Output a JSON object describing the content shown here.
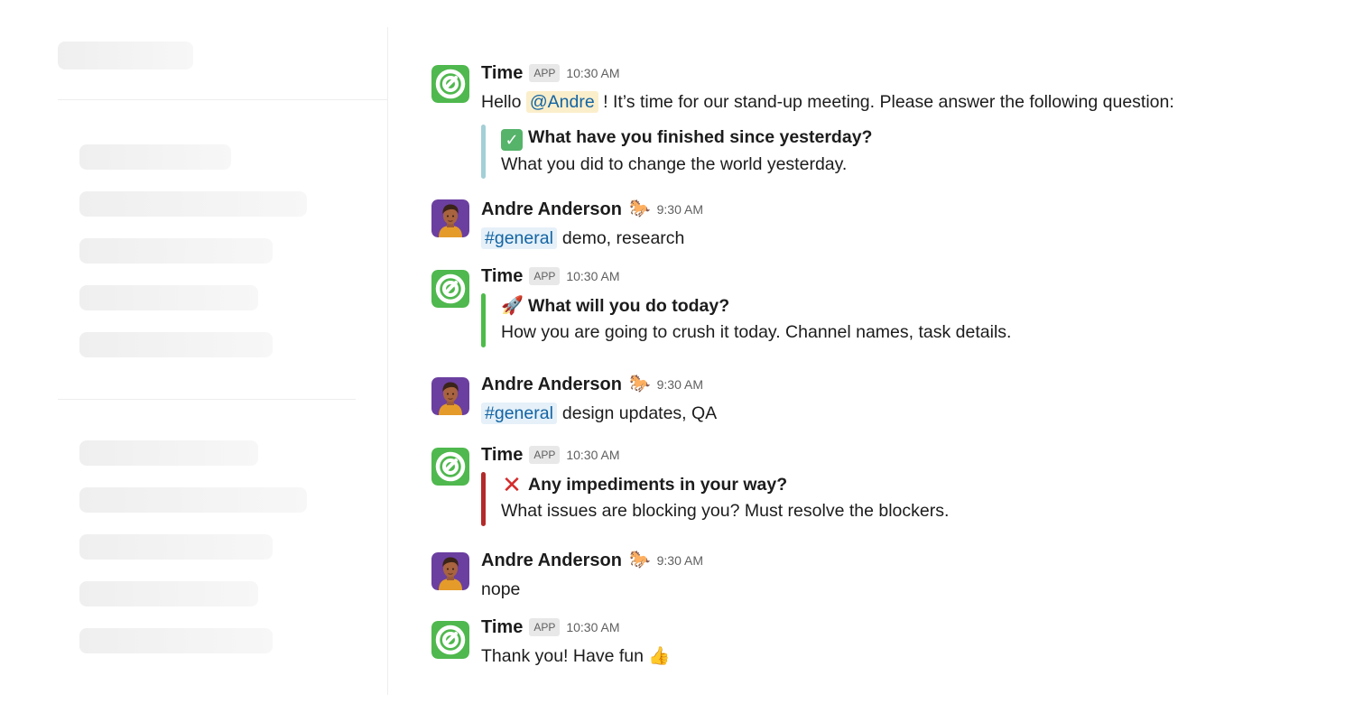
{
  "colors": {
    "app_icon_green": "#4fb84e",
    "mention_bg": "#fbeecb",
    "link_blue": "#1264a3",
    "channel_bg": "#e5f0f8",
    "attach_bar_teal": "#a3cfd6",
    "attach_bar_green": "#4dbb4a",
    "attach_bar_red": "#b32a2a"
  },
  "messages": [
    {
      "sender": "Time",
      "badge": "APP",
      "time": "10:30 AM",
      "text_prefix": "Hello ",
      "mention": "@Andre",
      "text_suffix": " ! It’s time for our stand-up meeting.  Please answer the following question:",
      "attachment": {
        "emoji": "check-mark-icon",
        "title": "What have you finished since yesterday?",
        "text": "What you did to change the world yesterday."
      }
    },
    {
      "sender": "Andre Anderson",
      "status_emoji": "🐎",
      "time": "9:30 AM",
      "channel": "#general",
      "text": "demo, research"
    },
    {
      "sender": "Time",
      "badge": "APP",
      "time": "10:30 AM",
      "attachment": {
        "emoji": "🚀",
        "title": "What will you do today?",
        "text": "How you are going to crush it today. Channel names, task details."
      }
    },
    {
      "sender": "Andre Anderson",
      "status_emoji": "🐎",
      "time": "9:30 AM",
      "channel": "#general",
      "text": "design updates, QA"
    },
    {
      "sender": "Time",
      "badge": "APP",
      "time": "10:30 AM",
      "attachment": {
        "emoji": "cross-mark-icon",
        "title": "Any impediments in your way?",
        "text": "What issues are blocking you? Must resolve the blockers."
      }
    },
    {
      "sender": "Andre Anderson",
      "status_emoji": "🐎",
      "time": "9:30 AM",
      "text": "nope"
    },
    {
      "sender": "Time",
      "badge": "APP",
      "time": "10:30 AM",
      "text": "Thank you! Have fun",
      "emoji": "👍"
    }
  ]
}
